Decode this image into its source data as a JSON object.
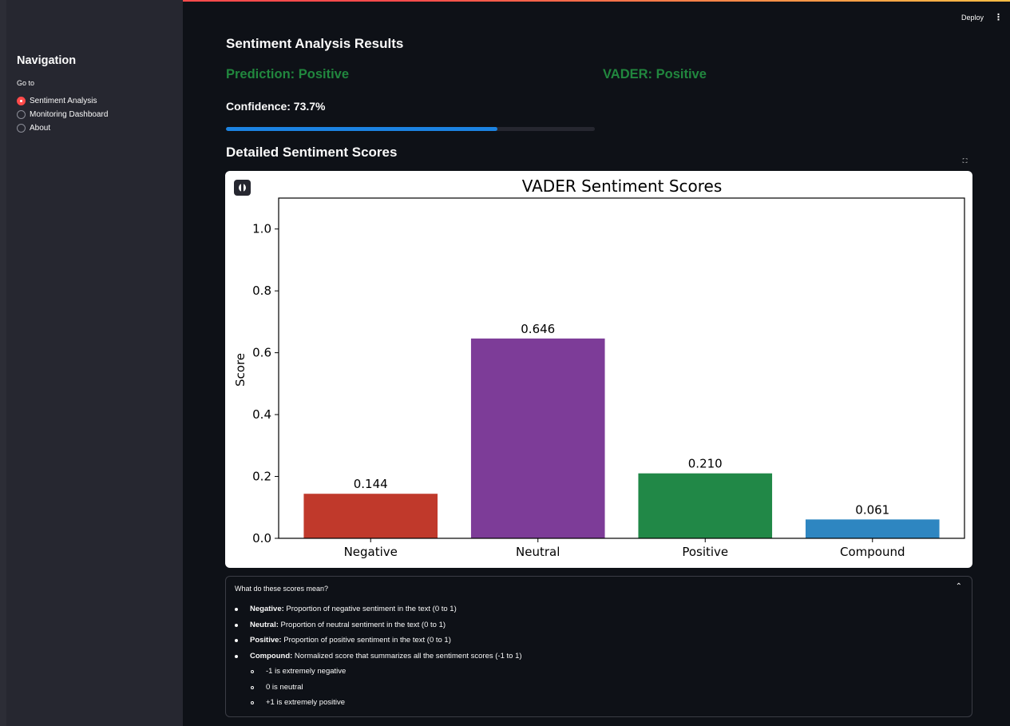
{
  "sidebar": {
    "title": "Navigation",
    "goto_label": "Go to",
    "items": [
      {
        "label": "Sentiment Analysis",
        "selected": true
      },
      {
        "label": "Monitoring Dashboard",
        "selected": false
      },
      {
        "label": "About",
        "selected": false
      }
    ]
  },
  "header": {
    "deploy_label": "Deploy",
    "menu_icon": "kebab-menu-icon"
  },
  "main": {
    "results_heading": "Sentiment Analysis Results",
    "prediction_text": "Prediction: Positive",
    "vader_text": "VADER: Positive",
    "confidence_text": "Confidence: 73.7%",
    "confidence_value": 0.737,
    "detailed_heading": "Detailed Sentiment Scores"
  },
  "colors": {
    "accent": "#ff4b4b",
    "positive_text": "#21873e",
    "progress": "#1c83e1"
  },
  "chart_data": {
    "type": "bar",
    "title": "VADER Sentiment Scores",
    "xlabel": "",
    "ylabel": "Score",
    "categories": [
      "Negative",
      "Neutral",
      "Positive",
      "Compound"
    ],
    "values": [
      0.144,
      0.646,
      0.21,
      0.061
    ],
    "value_labels": [
      "0.144",
      "0.646",
      "0.210",
      "0.061"
    ],
    "colors": [
      "#c0392b",
      "#7d3c98",
      "#218847",
      "#2e86c1"
    ],
    "ylim": [
      0,
      1.1
    ],
    "yticks": [
      "0.0",
      "0.2",
      "0.4",
      "0.6",
      "0.8",
      "1.0"
    ],
    "grid": false
  },
  "expander": {
    "title": "What do these scores mean?",
    "items": [
      {
        "term": "Negative:",
        "desc": " Proportion of negative sentiment in the text (0 to 1)"
      },
      {
        "term": "Neutral:",
        "desc": " Proportion of neutral sentiment in the text (0 to 1)"
      },
      {
        "term": "Positive:",
        "desc": " Proportion of positive sentiment in the text (0 to 1)"
      },
      {
        "term": "Compound:",
        "desc": " Normalized score that summarizes all the sentiment scores (-1 to 1)"
      }
    ],
    "subitems": [
      "-1 is extremely negative",
      "0 is neutral",
      "+1 is extremely positive"
    ]
  }
}
